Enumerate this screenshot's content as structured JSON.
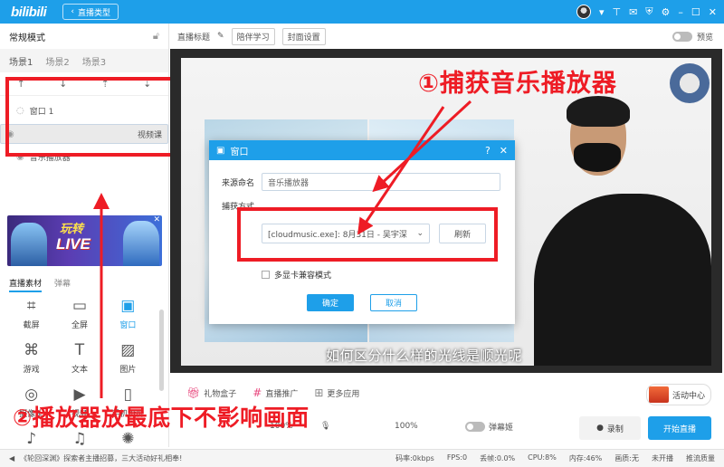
{
  "titlebar": {
    "logo": "bilibili",
    "type_button": "直播类型",
    "back_icon": "‹"
  },
  "left": {
    "mode_label": "常规模式",
    "scene_tabs": [
      "场景1",
      "场景2",
      "场景3"
    ],
    "sources": [
      "窗口 1",
      "视频课",
      "音乐播放器"
    ],
    "banner": {
      "line1": "玩转",
      "line2": "LIVE"
    },
    "material_tabs": [
      "直播素材",
      "弹幕"
    ],
    "materials": [
      "截屏",
      "全屏",
      "窗口",
      "游戏",
      "文本",
      "图片",
      "摄像头",
      "视频",
      "手机投屏",
      "",
      "音乐",
      ""
    ]
  },
  "main_toolbar": {
    "title_label": "直播标题",
    "chips": [
      "陪伴学习",
      "封面设置"
    ],
    "preview_label": "预览"
  },
  "video": {
    "subtitle": "如何区分什么样的光线是顺光呢"
  },
  "dialog": {
    "title": "窗口",
    "name_label": "来源命名",
    "name_value": "音乐播放器",
    "capture_label": "捕获方式",
    "window_select": "[cloudmusic.exe]: 8月31日 - 吴宇深",
    "refresh": "刷新",
    "compat_label": "多显卡兼容模式",
    "ok": "确定",
    "cancel": "取消"
  },
  "annotations": {
    "step1": "①捕获音乐播放器",
    "step2": "②播放器放最底下不影响画面"
  },
  "bottom": {
    "tools": [
      "礼物盒子",
      "直播推广",
      "更多应用"
    ],
    "activity": "活动中心",
    "volume1": "100%",
    "volume2": "100%",
    "danmaku_label": "弹幕姬",
    "record": "录制",
    "start_live": "开始直播"
  },
  "status": {
    "ticker": "《轮回深渊》探索者主播招募，三大活动好礼相奉!",
    "stats": [
      "码率:0kbps",
      "FPS:0",
      "丢帧:0.0%",
      "CPU:8%",
      "内存:46%",
      "画质:无",
      "未开播",
      "推流质量"
    ]
  },
  "colors": {
    "accent": "#1e9fe9",
    "annotation_red": "#ee1c25"
  }
}
